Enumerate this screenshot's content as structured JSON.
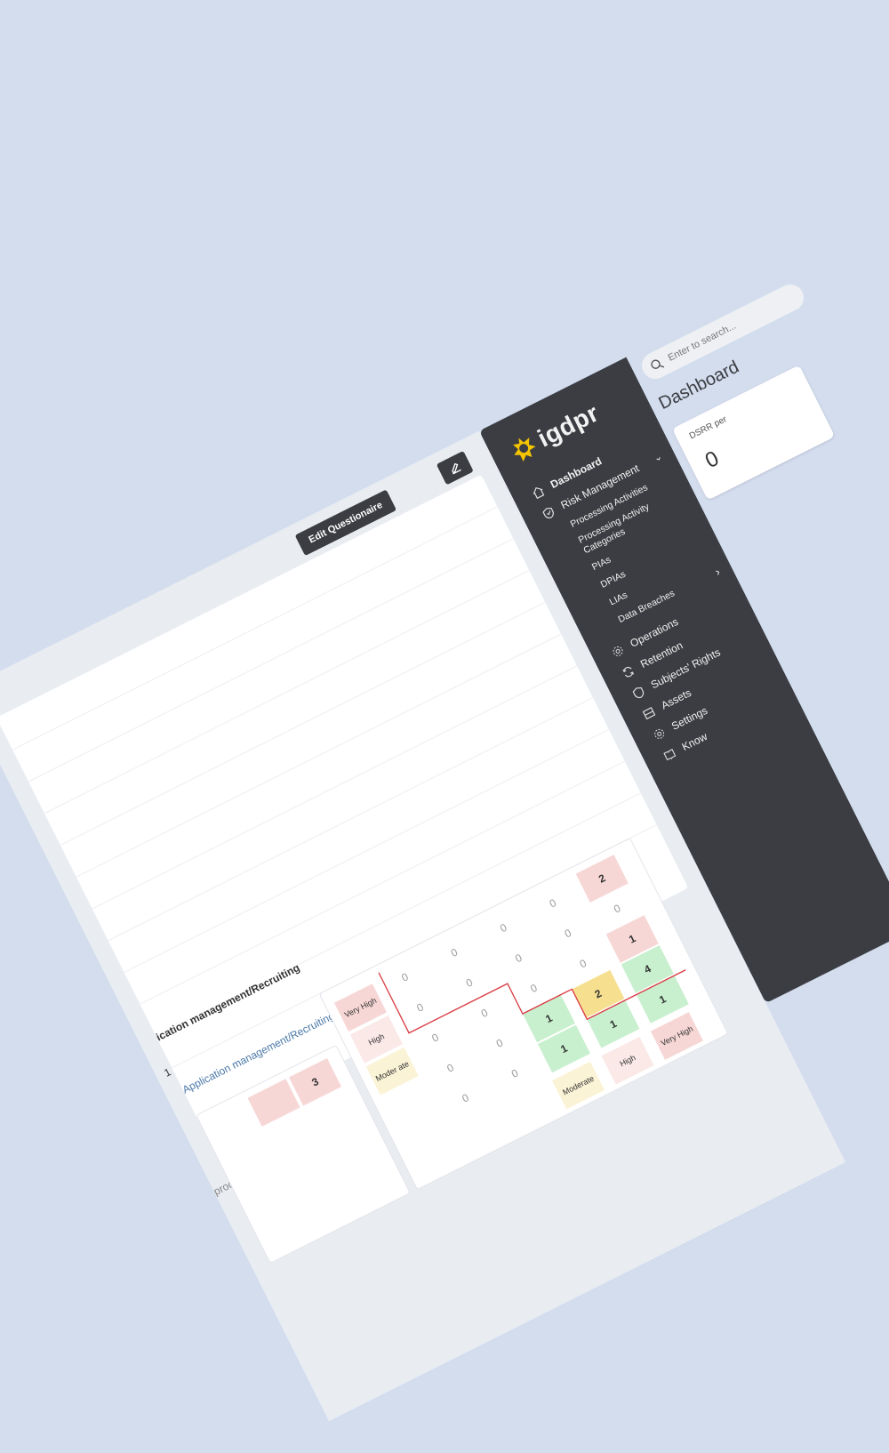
{
  "sidebar": {
    "logo_text": "igdpr",
    "nav": [
      {
        "label": "Dashboard",
        "icon": "home-icon",
        "active": true
      },
      {
        "label": "Risk Management",
        "icon": "shield-icon",
        "chevron": "⌄"
      }
    ],
    "risk_sub": [
      {
        "label": "Processing Activities"
      },
      {
        "label": "Processing Activity Categories"
      },
      {
        "label": "PIAs"
      },
      {
        "label": "DPIAs"
      },
      {
        "label": "LIAs"
      },
      {
        "label": "Data Breaches",
        "chevron": "›"
      }
    ],
    "nav_bottom": [
      {
        "label": "Operations",
        "icon": "gear-icon"
      },
      {
        "label": "Retention",
        "icon": "refresh-icon"
      },
      {
        "label": "Subjects' Rights",
        "icon": "shield-heart-icon"
      },
      {
        "label": "Assets",
        "icon": "archive-icon"
      },
      {
        "label": "Settings",
        "icon": "gear-icon"
      },
      {
        "label": "Know",
        "icon": "book-icon"
      }
    ]
  },
  "search": {
    "placeholder": "Enter to search..."
  },
  "main": {
    "title": "Dashboard",
    "stat_label": "DSRR per",
    "stat_value": "0"
  },
  "panel": {
    "edit_button": "Edit Questionaire",
    "texts": [
      "ication management/Recruiting",
      "1",
      "Application management/Recruiting",
      "—",
      "—",
      "processing is —",
      "—"
    ]
  },
  "left_card": {
    "value": "3"
  },
  "matrix": {
    "row_labels": [
      "Very High",
      "High",
      "Moder ate"
    ],
    "col_labels": [
      "Moderate",
      "High",
      "Very High"
    ],
    "cells": [
      [
        "0",
        "0",
        "0",
        "0",
        "2"
      ],
      [
        "0",
        "0",
        "0",
        "0",
        "0"
      ],
      [
        "0",
        "0",
        "0",
        "0",
        "1"
      ],
      [
        "0",
        "0",
        "1",
        "2",
        "4"
      ],
      [
        "0",
        "0",
        "1",
        "1",
        "1"
      ]
    ],
    "colors": {
      "red": "#f7d7d6",
      "yellow": "#f6df8f",
      "green": "#c8f0cf",
      "border_red": "#d9363e"
    }
  }
}
